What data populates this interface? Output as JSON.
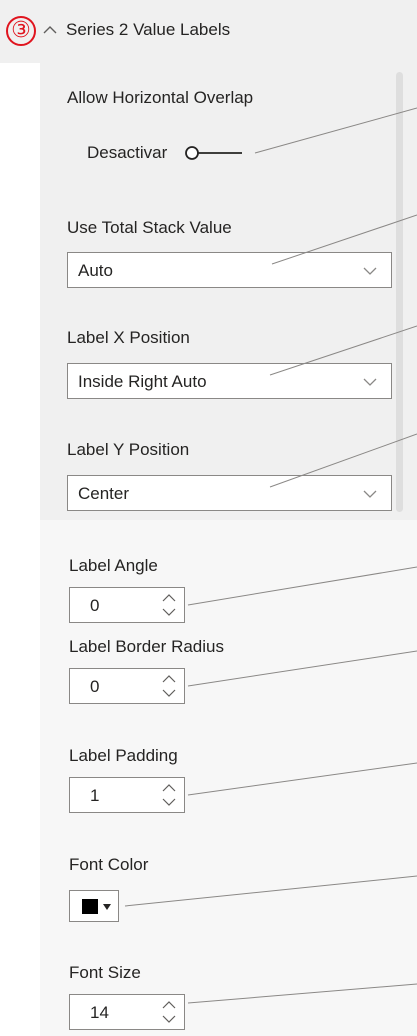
{
  "section": {
    "badge": "③",
    "title": "Series 2 Value Labels",
    "collapse_icon": "chevron-up-icon"
  },
  "allow_horizontal_overlap": {
    "label": "Allow Horizontal Overlap",
    "state_text": "Desactivar",
    "on": false
  },
  "use_total_stack_value": {
    "label": "Use Total Stack Value",
    "value": "Auto"
  },
  "label_x_position": {
    "label": "Label X Position",
    "value": "Inside Right Auto"
  },
  "label_y_position": {
    "label": "Label Y Position",
    "value": "Center"
  },
  "label_angle": {
    "label": "Label Angle",
    "value": "0"
  },
  "label_border_radius": {
    "label": "Label Border Radius",
    "value": "0"
  },
  "label_padding": {
    "label": "Label Padding",
    "value": "1"
  },
  "font_color": {
    "label": "Font Color",
    "value": "#000000"
  },
  "font_size": {
    "label": "Font Size",
    "value": "14"
  },
  "colors": {
    "badge_red": "#e0141e",
    "panel_bg": "#f0f0f0",
    "border": "#8a8886",
    "text": "#252423"
  }
}
